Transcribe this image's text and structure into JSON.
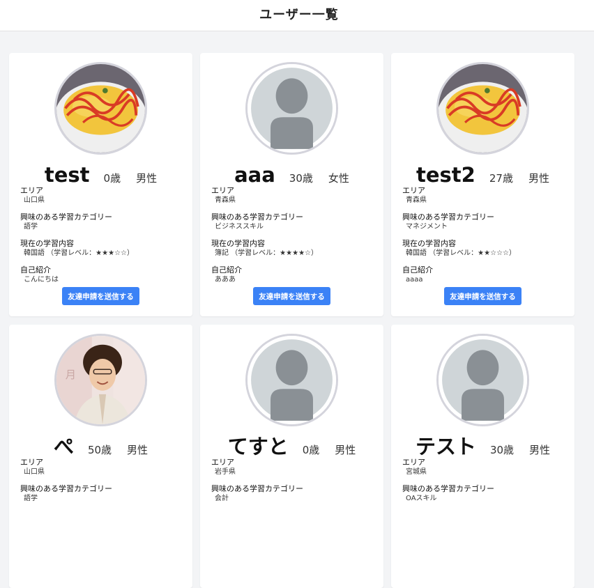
{
  "header": {
    "title": "ユーザー一覧"
  },
  "labels": {
    "area": "エリア",
    "category": "興味のある学習カテゴリー",
    "current": "現在の学習内容",
    "intro": "自己紹介",
    "friend_button": "友達申請を送信する"
  },
  "users": [
    {
      "name": "test",
      "age": "0歳",
      "gender": "男性",
      "avatar": "omelette-photo",
      "area": "山口県",
      "category": "語学",
      "current": "韓国語 （学習レベル：★★★☆☆）",
      "intro": "こんにちは"
    },
    {
      "name": "aaa",
      "age": "30歳",
      "gender": "女性",
      "avatar": "default-avatar",
      "area": "青森県",
      "category": "ビジネススキル",
      "current": "簿記 （学習レベル：★★★★☆）",
      "intro": "あああ"
    },
    {
      "name": "test2",
      "age": "27歳",
      "gender": "男性",
      "avatar": "omelette-photo",
      "area": "青森県",
      "category": "マネジメント",
      "current": "韓国語 （学習レベル：★★☆☆☆）",
      "intro": "aaaa"
    },
    {
      "name": "ぺ",
      "age": "50歳",
      "gender": "男性",
      "avatar": "person-photo",
      "area": "山口県",
      "category": "語学",
      "current": "",
      "intro": ""
    },
    {
      "name": "てすと",
      "age": "0歳",
      "gender": "男性",
      "avatar": "default-avatar",
      "area": "岩手県",
      "category": "会計",
      "current": "",
      "intro": ""
    },
    {
      "name": "テスト",
      "age": "30歳",
      "gender": "男性",
      "avatar": "default-avatar",
      "area": "宮城県",
      "category": "OAスキル",
      "current": "",
      "intro": ""
    }
  ],
  "colors": {
    "button": "#3b82f6",
    "background": "#f3f4f6",
    "avatar_border": "#d4d4dc"
  }
}
